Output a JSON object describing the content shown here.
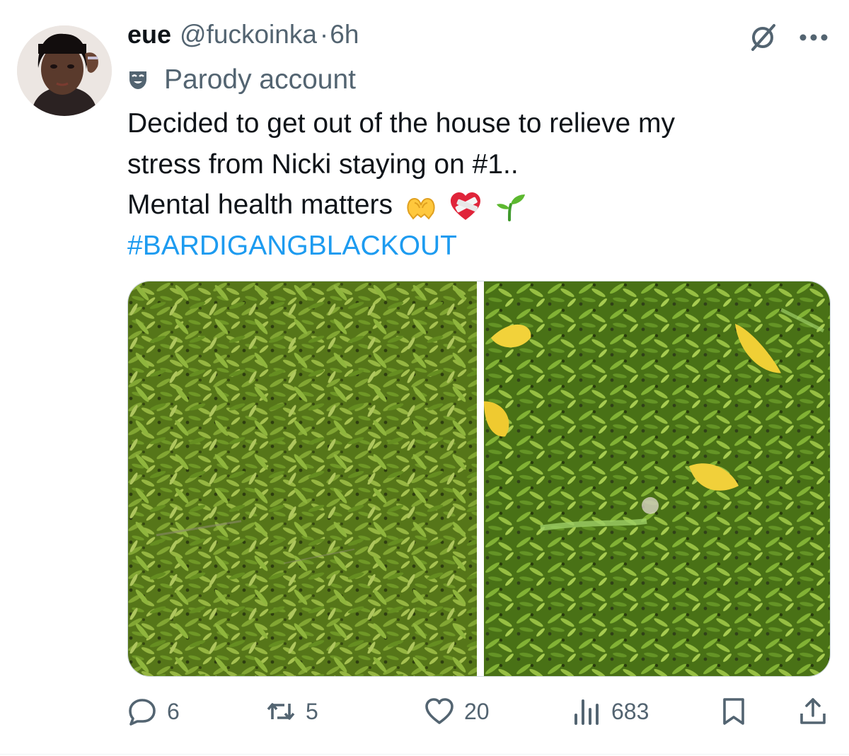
{
  "tweet": {
    "author_name": "eue",
    "author_handle": "@fuckoinka",
    "separator": "·",
    "time": "6h",
    "parody_label": "Parody account",
    "text_lines": [
      "Decided to get out of the house to relieve my",
      "stress from Nicki staying on #1..",
      "Mental health matters"
    ],
    "emojis": [
      "heart-hands",
      "mending-heart",
      "seedling"
    ],
    "hashtag": "#BARDIGANGBLACKOUT",
    "media": [
      {
        "kind": "photo",
        "subject": "green shrub foliage"
      },
      {
        "kind": "photo",
        "subject": "green shrub foliage with yellow leaves"
      }
    ]
  },
  "actions": {
    "replies": "6",
    "reposts": "5",
    "likes": "20",
    "views": "683"
  },
  "icons": {
    "grok": "grok-icon",
    "more": "more-icon",
    "parody": "parody-mask-icon",
    "reply": "reply-icon",
    "repost": "repost-icon",
    "like": "heart-icon",
    "views": "views-icon",
    "bookmark": "bookmark-icon",
    "share": "share-icon"
  },
  "colors": {
    "text": "#0f1419",
    "secondary": "#536471",
    "link": "#1d9bf0"
  }
}
